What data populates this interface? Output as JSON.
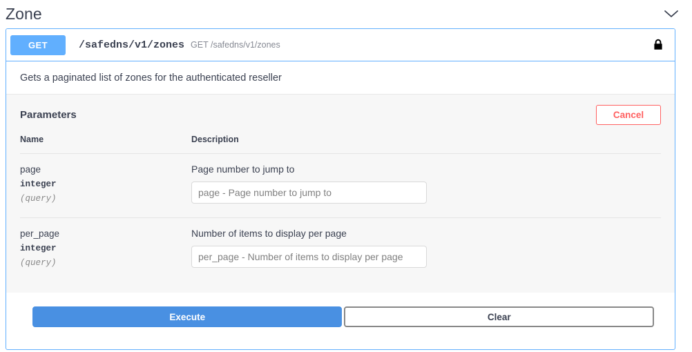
{
  "tag": {
    "title": "Zone",
    "collapse_icon": "chevron-down-icon"
  },
  "operation": {
    "method": "GET",
    "path": "/safedns/v1/zones",
    "summary": "GET /safedns/v1/zones",
    "auth_icon": "lock-icon",
    "description": "Gets a paginated list of zones for the authenticated reseller"
  },
  "parameters_section": {
    "title": "Parameters",
    "cancel_label": "Cancel",
    "columns": {
      "name": "Name",
      "description": "Description"
    },
    "rows": [
      {
        "name": "page",
        "type": "integer",
        "in": "(query)",
        "description": "Page number to jump to",
        "value": "",
        "placeholder": "page - Page number to jump to"
      },
      {
        "name": "per_page",
        "type": "integer",
        "in": "(query)",
        "description": "Number of items to display per page",
        "value": "",
        "placeholder": "per_page - Number of items to display per page"
      }
    ]
  },
  "actions": {
    "execute_label": "Execute",
    "clear_label": "Clear"
  },
  "colors": {
    "method_get": "#61affe",
    "block_border": "#61affe",
    "cancel": "#ff6060",
    "execute": "#4990e2",
    "text": "#3b4151",
    "panel_bg": "#f7f7f7"
  }
}
